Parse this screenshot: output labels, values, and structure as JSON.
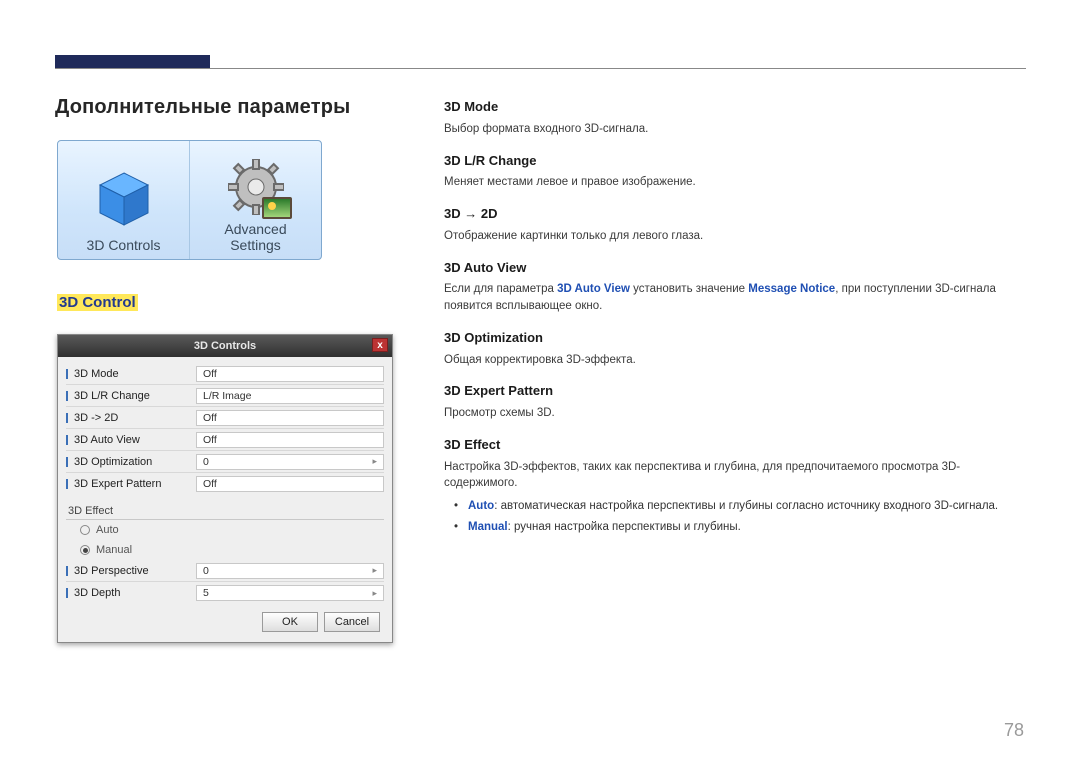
{
  "page": {
    "title": "Дополнительные параметры",
    "subhead": "3D Control",
    "page_number": "78"
  },
  "icons_card": {
    "left_label": "3D Controls",
    "right_label_line1": "Advanced",
    "right_label_line2": "Settings"
  },
  "dialog": {
    "title": "3D Controls",
    "close": "x",
    "rows": [
      {
        "label": "3D Mode",
        "value": "Off"
      },
      {
        "label": "3D L/R Change",
        "value": "L/R Image"
      },
      {
        "label": "3D -> 2D",
        "value": "Off"
      },
      {
        "label": "3D Auto View",
        "value": "Off"
      },
      {
        "label": "3D Optimization",
        "value": "0",
        "slider": true
      },
      {
        "label": "3D Expert Pattern",
        "value": "Off"
      }
    ],
    "effect_section": "3D Effect",
    "radios": [
      {
        "label": "Auto",
        "selected": false
      },
      {
        "label": "Manual",
        "selected": true
      }
    ],
    "slider_rows": [
      {
        "label": "3D Perspective",
        "value": "0"
      },
      {
        "label": "3D Depth",
        "value": "5"
      }
    ],
    "buttons": {
      "ok": "OK",
      "cancel": "Cancel"
    }
  },
  "text": {
    "h_mode": "3D Mode",
    "p_mode": "Выбор формата входного 3D-сигнала.",
    "h_lr": "3D L/R Change",
    "p_lr": "Меняет местами левое и правое изображение.",
    "h_2d": "3D → 2D",
    "p_2d": "Отображение картинки только для левого глаза.",
    "h_auto": "3D Auto View",
    "p_auto_pre": "Если для параметра ",
    "p_auto_blue1": "3D Auto View",
    "p_auto_mid": " установить значение ",
    "p_auto_blue2": "Message Notice",
    "p_auto_post": ", при поступлении 3D-сигнала появится всплывающее окно.",
    "h_opt": "3D Optimization",
    "p_opt": "Общая корректировка 3D-эффекта.",
    "h_pat": "3D Expert Pattern",
    "p_pat": "Просмотр схемы 3D.",
    "h_eff": "3D Effect",
    "p_eff": "Настройка 3D-эффектов, таких как перспектива и глубина, для предпочитаемого просмотра 3D-содержимого.",
    "li1_bold": "Auto",
    "li1_rest": ": автоматическая настройка перспективы и глубины согласно источнику входного 3D-сигнала.",
    "li2_bold": "Manual",
    "li2_rest": ": ручная настройка перспективы и глубины."
  }
}
